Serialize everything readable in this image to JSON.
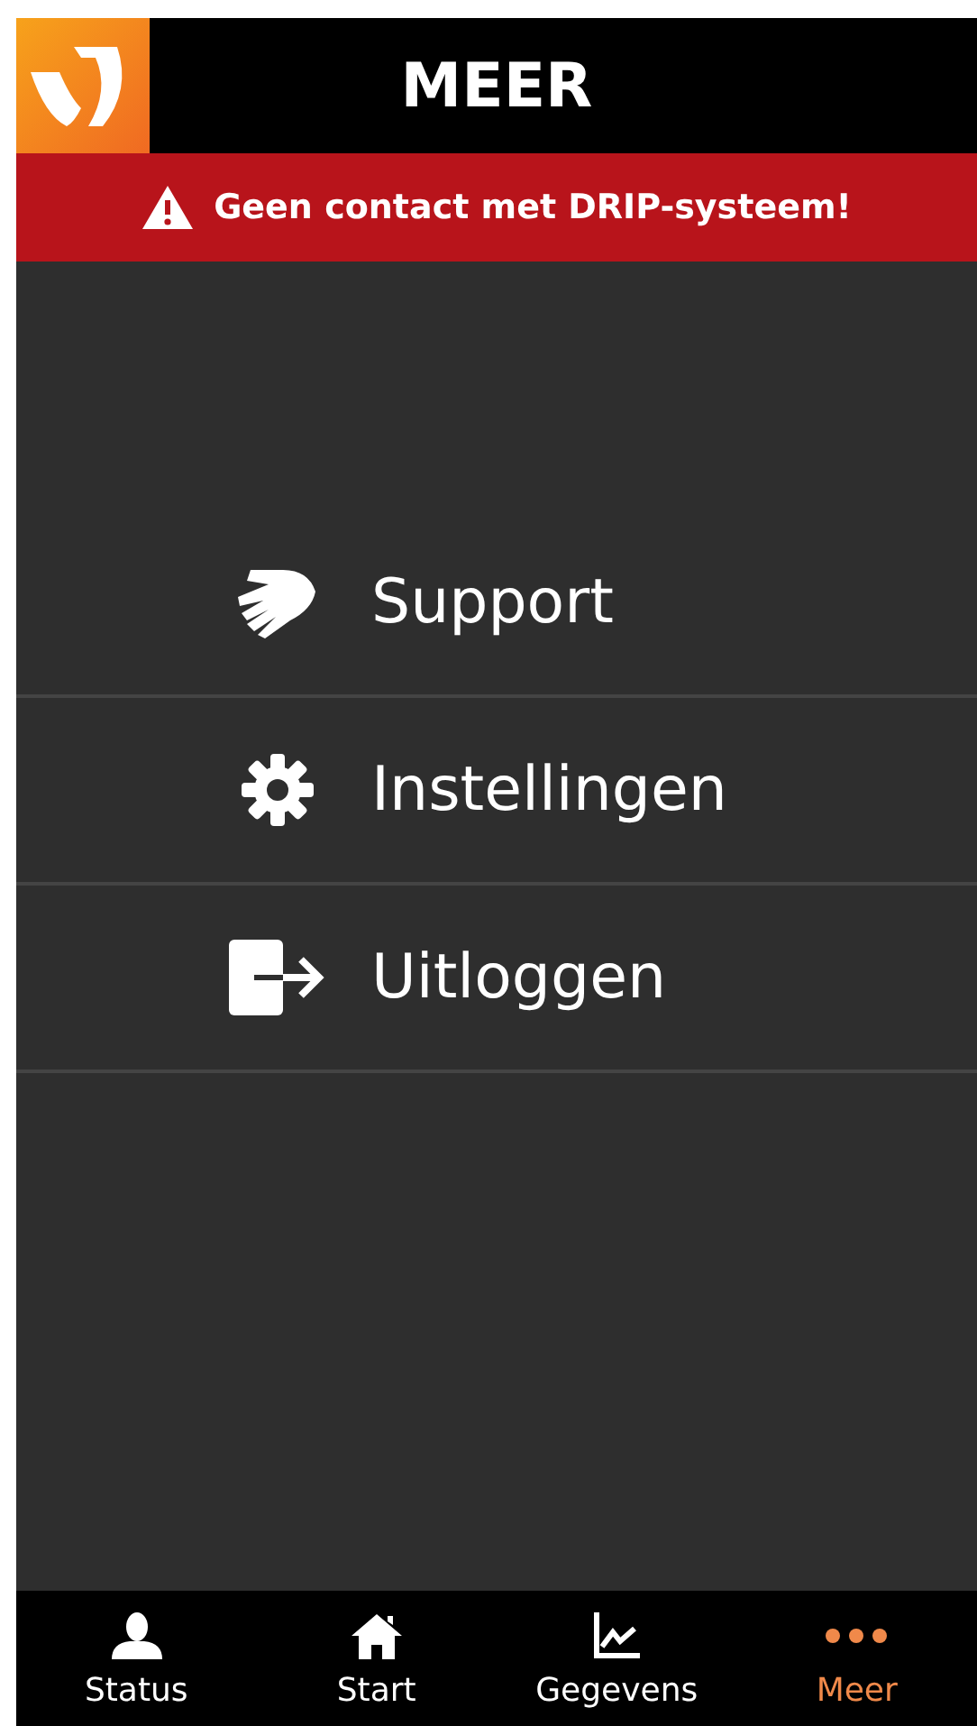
{
  "header": {
    "title": "MEER"
  },
  "alert": {
    "message": "Geen contact met DRIP-systeem!"
  },
  "menu": [
    {
      "kind": "hand",
      "label": "Support"
    },
    {
      "kind": "gear",
      "label": "Instellingen"
    },
    {
      "kind": "logout",
      "label": "Uitloggen"
    }
  ],
  "tabs": [
    {
      "kind": "person",
      "label": "Status",
      "selected": false
    },
    {
      "kind": "house",
      "label": "Start",
      "selected": false
    },
    {
      "kind": "chart",
      "label": "Gegevens",
      "selected": false
    },
    {
      "kind": "dots",
      "label": "Meer",
      "selected": true
    }
  ]
}
